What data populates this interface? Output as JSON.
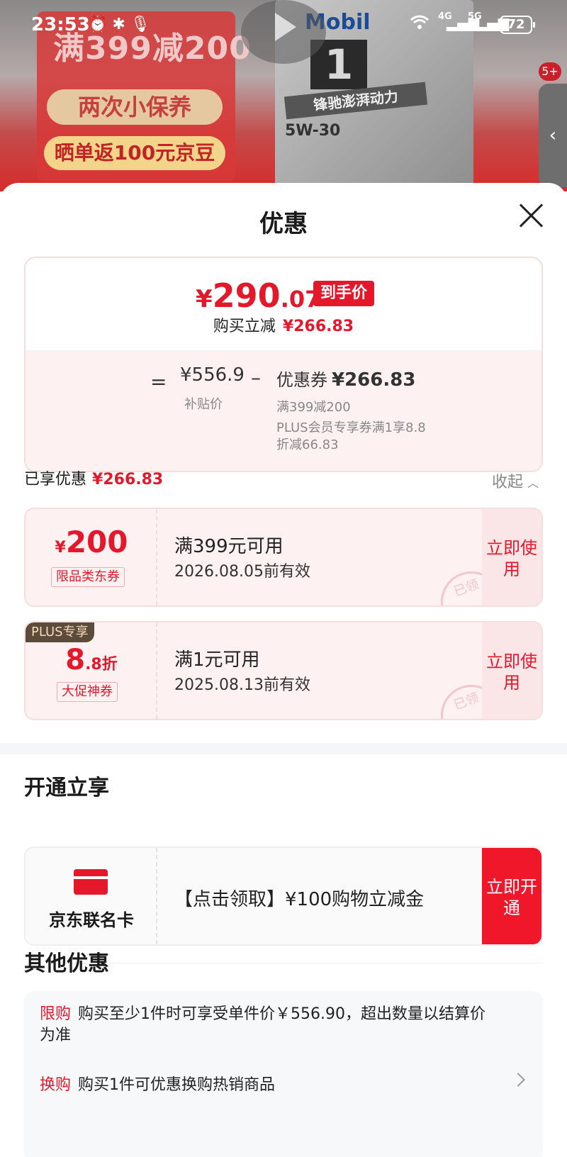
{
  "status_bar": {
    "time": "23:53",
    "icons_left": "⏰ ✱ 🎙",
    "wifi": "wifi-icon",
    "net1": "4G",
    "net2": "5G",
    "battery": "72"
  },
  "banner": {
    "promo_line1": "满399减200",
    "promo_line2": "两次小保养",
    "promo_line3": "晒单返100元京豆",
    "brand": "Mobil",
    "brand_num": "1",
    "slogan": "锋驰澎湃动力",
    "grade": "5W-30",
    "badge": "5+",
    "side_arrow": "‹"
  },
  "sheet": {
    "title": "优惠",
    "close_icon": "close-icon"
  },
  "price_card": {
    "final_symbol": "¥",
    "final_int": "290",
    "final_dec": ".07",
    "final_tag": "到手价",
    "direct_cut_label": "购买立减",
    "direct_cut_value": "¥266.83",
    "equals": "=",
    "base_price": "¥556.9",
    "base_label": "补贴价",
    "minus": "–",
    "coupon_label": "优惠券",
    "coupon_amount": "¥266.83",
    "coupon_detail1": "满399减200",
    "coupon_detail2": "PLUS会员专享券满1享8.8折减66.83"
  },
  "enjoyed": {
    "label": "已享优惠",
    "value": "¥266.83",
    "collapse_label": "收起"
  },
  "coupons": [
    {
      "amount_symbol": "¥",
      "amount": "200",
      "type": "限品类东券",
      "condition": "满399元可用",
      "validity": "2026.08.05前有效",
      "button": "立即使用",
      "stamp": "已领"
    },
    {
      "plus_tag": "PLUS专享",
      "amount_int": "8",
      "amount_dec": ".8折",
      "type": "大促神券",
      "condition": "满1元可用",
      "validity": "2025.08.13前有效",
      "button": "立即使用",
      "stamp": "已领"
    }
  ],
  "open_section": {
    "title": "开通立享",
    "card_name": "京东联名卡",
    "card_icon": "credit-card-icon",
    "offer_text": "【点击领取】¥100购物立减金",
    "button": "立即开通"
  },
  "other_section": {
    "title": "其他优惠",
    "items": [
      {
        "tag": "限购",
        "text": "购买至少1件时可享受单件价￥556.90，超出数量以结算价为准"
      },
      {
        "tag": "换购",
        "text": "购买1件可优惠换购热销商品"
      }
    ]
  }
}
